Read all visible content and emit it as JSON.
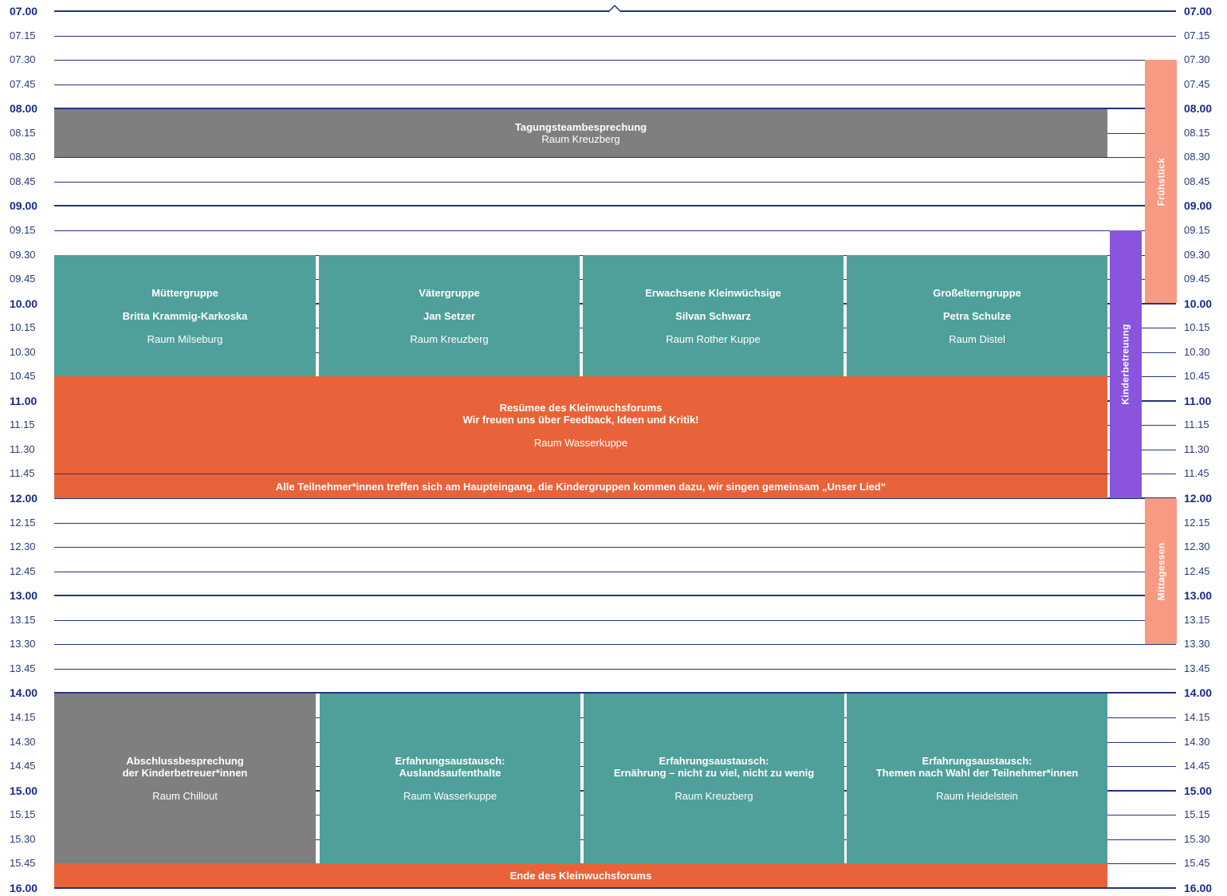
{
  "times": [
    "07.00",
    "07.15",
    "07.30",
    "07.45",
    "08.00",
    "08.15",
    "08.30",
    "08.45",
    "09.00",
    "09.15",
    "09.30",
    "09.45",
    "10.00",
    "10.15",
    "10.30",
    "10.45",
    "11.00",
    "11.15",
    "11.30",
    "11.45",
    "12.00",
    "12.15",
    "12.30",
    "12.45",
    "13.00",
    "13.15",
    "13.30",
    "13.45",
    "14.00",
    "14.15",
    "14.30",
    "14.45",
    "15.00",
    "15.15",
    "15.30",
    "15.45",
    "16.00"
  ],
  "blocks": {
    "tagungsteam": {
      "title": "Tagungsteambesprechung",
      "room": "Raum Kreuzberg"
    },
    "muetter": {
      "title": "Müttergruppe",
      "person": "Britta Krammig-Karkoska",
      "room": "Raum Milseburg"
    },
    "vaeter": {
      "title": "Vätergruppe",
      "person": "Jan Setzer",
      "room": "Raum Kreuzberg"
    },
    "erwachsene": {
      "title": "Erwachsene Kleinwüchsige",
      "person": "Silvan Schwarz",
      "room": "Raum Rother Kuppe"
    },
    "grosseltern": {
      "title": "Großelterngruppe",
      "person": "Petra Schulze",
      "room": "Raum Distel"
    },
    "resuemee": {
      "title1": "Resümee des Kleinwuchsforums",
      "title2": "Wir freuen uns über Feedback, Ideen und Kritik!",
      "room": "Raum Wasserkuppe"
    },
    "alle": {
      "text": "Alle Teilnehmer*innen treffen sich am Haupteingang, die Kindergruppen kommen dazu, wir singen gemeinsam „Unser Lied“"
    },
    "abschluss": {
      "title1": "Abschlussbesprechung",
      "title2": "der Kinderbetreuer*innen",
      "room": "Raum Chillout"
    },
    "ausland": {
      "title1": "Erfahrungsaustausch:",
      "title2": "Auslandsaufenthalte",
      "room": "Raum Wasserkuppe"
    },
    "ernaehrung": {
      "title1": "Erfahrungsaustausch:",
      "title2": "Ernährung – nicht zu viel, nicht zu wenig",
      "room": "Raum Kreuzberg"
    },
    "themen": {
      "title1": "Erfahrungsaustausch:",
      "title2": "Themen nach Wahl der Teilnehmer*innen",
      "room": "Raum Heidelstein"
    },
    "ende": {
      "text": "Ende des Kleinwuchsforums"
    },
    "fruehstueck": {
      "text": "Frühstück"
    },
    "kinderbetreuung": {
      "text": "Kinderbetreuung"
    },
    "mittagessen": {
      "text": "Mittagessen"
    }
  },
  "colors": {
    "line": "#23357f",
    "gray": "#7f7f7f",
    "teal": "#4f9f9a",
    "orange": "#e9633a",
    "peach": "#f79a83",
    "purple": "#8a55dc"
  }
}
